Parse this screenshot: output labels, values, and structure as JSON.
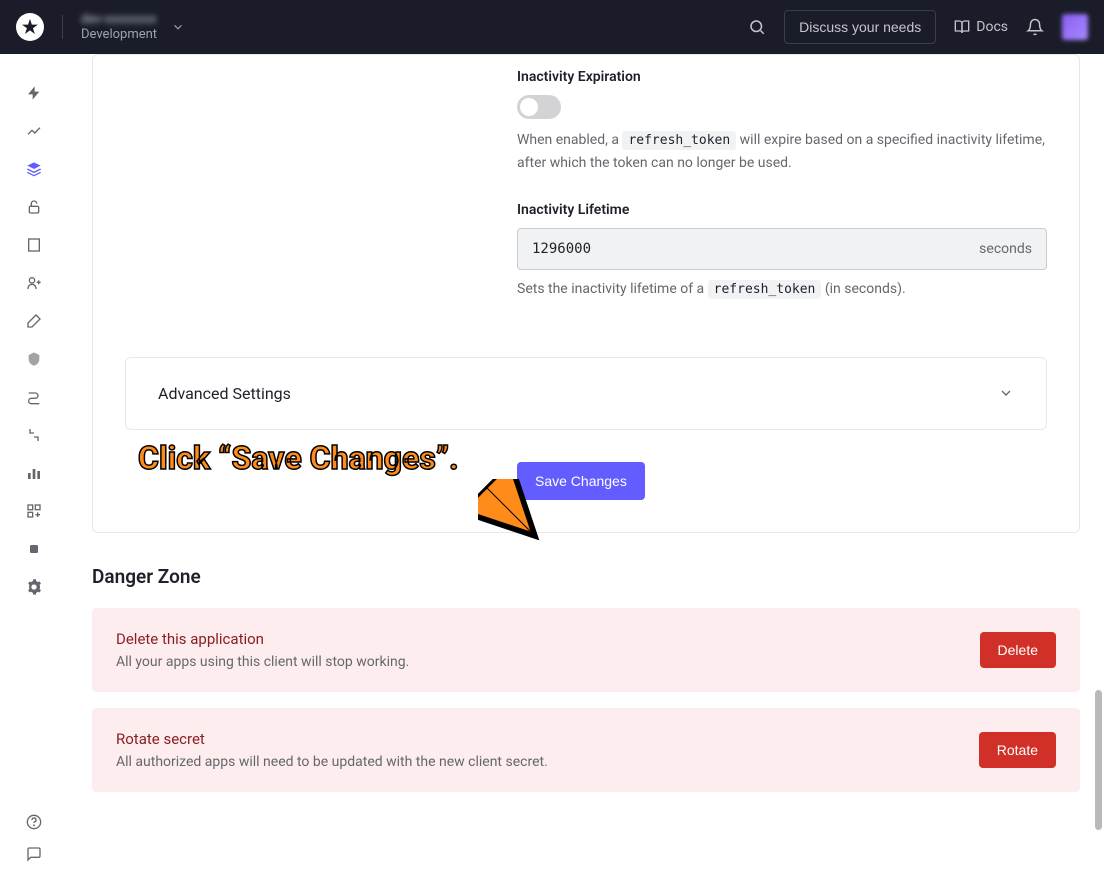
{
  "header": {
    "tenant_name": "dev-xxxxxxxx",
    "tenant_env": "Development",
    "discuss_label": "Discuss your needs",
    "docs_label": "Docs"
  },
  "settings": {
    "inactivity_expiration": {
      "label": "Inactivity Expiration",
      "help_pre": "When enabled, a ",
      "help_code": "refresh_token",
      "help_post": " will expire based on a specified inactivity lifetime, after which the token can no longer be used."
    },
    "inactivity_lifetime": {
      "label": "Inactivity Lifetime",
      "value": "1296000",
      "suffix": "seconds",
      "help_pre": "Sets the inactivity lifetime of a ",
      "help_code": "refresh_token",
      "help_post": " (in seconds)."
    },
    "advanced_label": "Advanced Settings",
    "save_label": "Save Changes"
  },
  "danger_zone": {
    "title": "Danger Zone",
    "delete": {
      "title": "Delete this application",
      "desc": "All your apps using this client will stop working.",
      "button": "Delete"
    },
    "rotate": {
      "title": "Rotate secret",
      "desc": "All authorized apps will need to be updated with the new client secret.",
      "button": "Rotate"
    }
  },
  "annotation": {
    "text": "Click “Save Changes”."
  }
}
